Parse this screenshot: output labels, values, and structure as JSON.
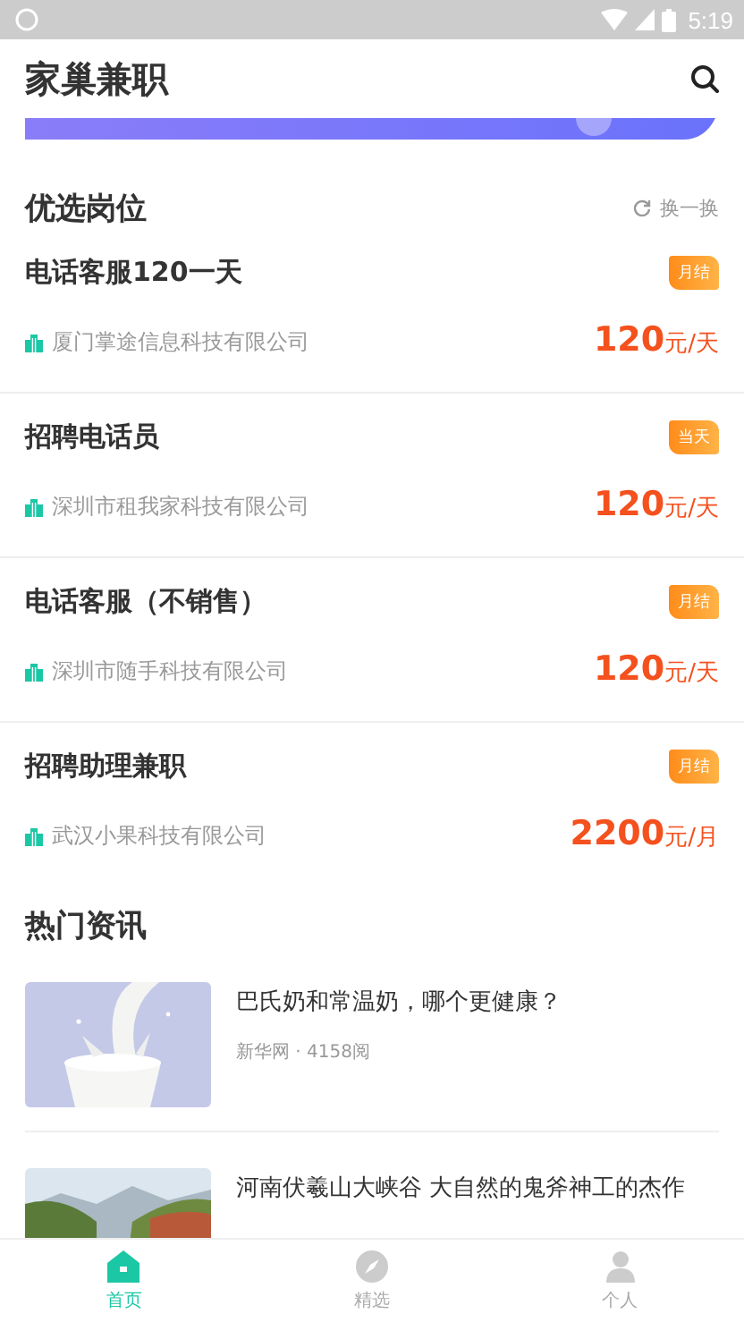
{
  "status_bar": {
    "time": "5:19"
  },
  "header": {
    "title": "家巢兼职"
  },
  "featured_section": {
    "title": "优选岗位",
    "refresh_label": "换一换"
  },
  "jobs": [
    {
      "title": "电话客服120一天",
      "tag": "月结",
      "company": "厦门掌途信息科技有限公司",
      "pay_amount": "120",
      "pay_unit": "元/天"
    },
    {
      "title": "招聘电话员",
      "tag": "当天",
      "company": "深圳市租我家科技有限公司",
      "pay_amount": "120",
      "pay_unit": "元/天"
    },
    {
      "title": "电话客服（不销售）",
      "tag": "月结",
      "company": "深圳市随手科技有限公司",
      "pay_amount": "120",
      "pay_unit": "元/天"
    },
    {
      "title": "招聘助理兼职",
      "tag": "月结",
      "company": "武汉小果科技有限公司",
      "pay_amount": "2200",
      "pay_unit": "元/月"
    }
  ],
  "news_section": {
    "title": "热门资讯"
  },
  "news": [
    {
      "title": "巴氏奶和常温奶，哪个更健康？",
      "meta": "新华网 · 4158阅"
    },
    {
      "title": "河南伏羲山大峡谷 大自然的鬼斧神工的杰作"
    }
  ],
  "tabs": [
    {
      "label": "首页",
      "selected": true
    },
    {
      "label": "精选",
      "selected": false
    },
    {
      "label": "个人",
      "selected": false
    }
  ]
}
